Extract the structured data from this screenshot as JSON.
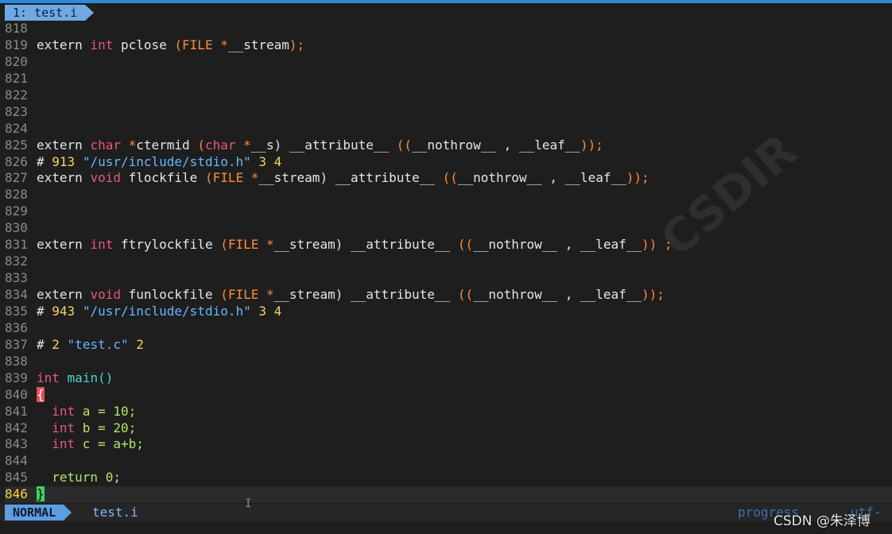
{
  "tab": {
    "label": "1: test.i"
  },
  "lines": [
    {
      "n": "818",
      "t": []
    },
    {
      "n": "819",
      "t": [
        [
          "plain",
          "extern "
        ],
        [
          "type",
          "int"
        ],
        [
          "plain",
          " pclose "
        ],
        [
          "paren",
          "(FILE "
        ],
        [
          "kw",
          "*"
        ],
        [
          "plain",
          "__stream"
        ],
        [
          "paren",
          ");"
        ]
      ]
    },
    {
      "n": "820",
      "t": []
    },
    {
      "n": "821",
      "t": []
    },
    {
      "n": "822",
      "t": []
    },
    {
      "n": "823",
      "t": []
    },
    {
      "n": "824",
      "t": []
    },
    {
      "n": "825",
      "t": [
        [
          "plain",
          "extern "
        ],
        [
          "type",
          "char"
        ],
        [
          "plain",
          " "
        ],
        [
          "kw",
          "*"
        ],
        [
          "plain",
          "ctermid "
        ],
        [
          "paren",
          "("
        ],
        [
          "type",
          "char"
        ],
        [
          "plain",
          " "
        ],
        [
          "kw",
          "*"
        ],
        [
          "plain",
          "__s) __attribute__ "
        ],
        [
          "paren",
          "(("
        ],
        [
          "plain",
          "__nothrow__ , __leaf__"
        ],
        [
          "paren",
          "));"
        ]
      ]
    },
    {
      "n": "826",
      "t": [
        [
          "plain",
          "# "
        ],
        [
          "num",
          "913"
        ],
        [
          "plain",
          " "
        ],
        [
          "str",
          "\"/usr/include/stdio.h\""
        ],
        [
          "plain",
          " "
        ],
        [
          "num",
          "3 4"
        ]
      ]
    },
    {
      "n": "827",
      "t": [
        [
          "plain",
          "extern "
        ],
        [
          "type",
          "void"
        ],
        [
          "plain",
          " flockfile "
        ],
        [
          "paren",
          "(FILE "
        ],
        [
          "kw",
          "*"
        ],
        [
          "plain",
          "__stream) __attribute__ "
        ],
        [
          "paren",
          "(("
        ],
        [
          "plain",
          "__nothrow__ , __leaf__"
        ],
        [
          "paren",
          "));"
        ]
      ]
    },
    {
      "n": "828",
      "t": []
    },
    {
      "n": "829",
      "t": []
    },
    {
      "n": "830",
      "t": []
    },
    {
      "n": "831",
      "t": [
        [
          "plain",
          "extern "
        ],
        [
          "type",
          "int"
        ],
        [
          "plain",
          " ftrylockfile "
        ],
        [
          "paren",
          "(FILE "
        ],
        [
          "kw",
          "*"
        ],
        [
          "plain",
          "__stream) __attribute__ "
        ],
        [
          "paren",
          "(("
        ],
        [
          "plain",
          "__nothrow__ , __leaf__"
        ],
        [
          "paren",
          ")) ;"
        ]
      ]
    },
    {
      "n": "832",
      "t": []
    },
    {
      "n": "833",
      "t": []
    },
    {
      "n": "834",
      "t": [
        [
          "plain",
          "extern "
        ],
        [
          "type",
          "void"
        ],
        [
          "plain",
          " funlockfile "
        ],
        [
          "paren",
          "(FILE "
        ],
        [
          "kw",
          "*"
        ],
        [
          "plain",
          "__stream) __attribute__ "
        ],
        [
          "paren",
          "(("
        ],
        [
          "plain",
          "__nothrow__ , __leaf__"
        ],
        [
          "paren",
          "));"
        ]
      ]
    },
    {
      "n": "835",
      "t": [
        [
          "plain",
          "# "
        ],
        [
          "num",
          "943"
        ],
        [
          "plain",
          " "
        ],
        [
          "str",
          "\"/usr/include/stdio.h\""
        ],
        [
          "plain",
          " "
        ],
        [
          "num",
          "3 4"
        ]
      ]
    },
    {
      "n": "836",
      "t": []
    },
    {
      "n": "837",
      "t": [
        [
          "plain",
          "# "
        ],
        [
          "num",
          "2"
        ],
        [
          "plain",
          " "
        ],
        [
          "str",
          "\"test.c\""
        ],
        [
          "plain",
          " "
        ],
        [
          "num",
          "2"
        ]
      ]
    },
    {
      "n": "838",
      "t": []
    },
    {
      "n": "839",
      "t": [
        [
          "type",
          "int"
        ],
        [
          "plain",
          " "
        ],
        [
          "fn",
          "main()"
        ]
      ]
    },
    {
      "n": "840",
      "t": [
        [
          "bracehl",
          "{"
        ]
      ]
    },
    {
      "n": "841",
      "t": [
        [
          "plain",
          "  "
        ],
        [
          "type",
          "int"
        ],
        [
          "green",
          " a = 10;"
        ]
      ]
    },
    {
      "n": "842",
      "t": [
        [
          "plain",
          "  "
        ],
        [
          "type",
          "int"
        ],
        [
          "green",
          " b = 20;"
        ]
      ]
    },
    {
      "n": "843",
      "t": [
        [
          "plain",
          "  "
        ],
        [
          "type",
          "int"
        ],
        [
          "green",
          " c = a+b;"
        ]
      ]
    },
    {
      "n": "844",
      "t": []
    },
    {
      "n": "845",
      "t": [
        [
          "plain",
          "  "
        ],
        [
          "green",
          "return 0;"
        ]
      ]
    },
    {
      "n": "846",
      "t": [
        [
          "bracecur",
          "}"
        ]
      ],
      "current": true
    }
  ],
  "status": {
    "mode": "NORMAL",
    "filename": "test.i",
    "progress": "progress",
    "encoding": "utf-"
  },
  "watermark": "CSDN @朱泽博",
  "ghost_watermark": "CSDIR",
  "colors": {
    "accent": "#5d9de0",
    "keyword": "#ff8a3d",
    "type": "#e65a77",
    "string": "#66b8ff",
    "number": "#f6d365"
  }
}
